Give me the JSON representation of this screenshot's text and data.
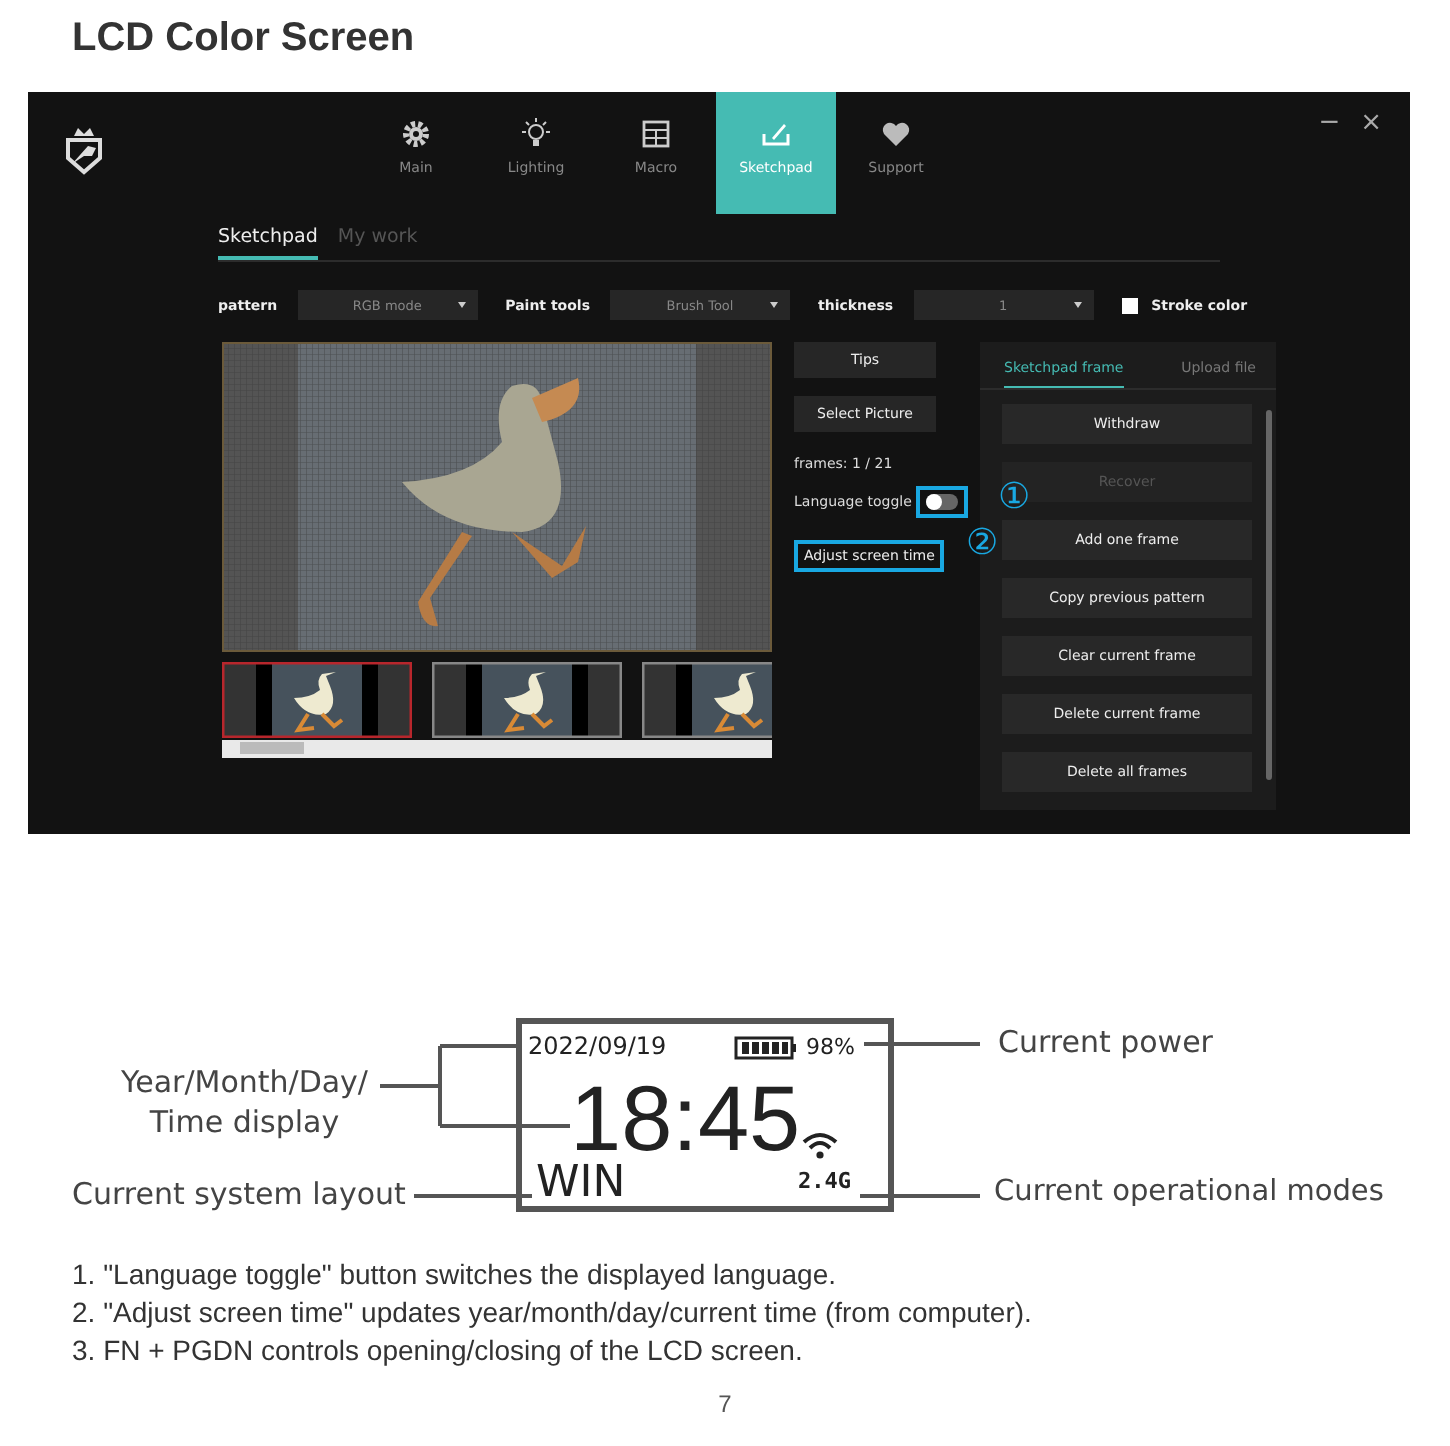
{
  "heading": "LCD Color Screen",
  "app": {
    "nav": [
      {
        "label": "Main",
        "kind": "gear",
        "selected": false
      },
      {
        "label": "Lighting",
        "kind": "bulb",
        "selected": false
      },
      {
        "label": "Macro",
        "kind": "table",
        "selected": false
      },
      {
        "label": "Sketchpad",
        "kind": "pad",
        "selected": true
      },
      {
        "label": "Support",
        "kind": "heart",
        "selected": false
      }
    ],
    "window_controls": [
      "−",
      "×"
    ],
    "subtabs": [
      {
        "label": "Sketchpad",
        "selected": true
      },
      {
        "label": "My work",
        "selected": false
      }
    ],
    "fields": [
      {
        "label": "pattern",
        "value": "RGB mode"
      },
      {
        "label": "Paint tools",
        "value": "Brush Tool"
      },
      {
        "label": "thickness",
        "value": "1"
      }
    ],
    "stroke_color": {
      "label": "Stroke color",
      "checked": false
    },
    "thumbnails": [
      {
        "selected": true
      },
      {
        "selected": false
      },
      {
        "selected": false
      }
    ],
    "side_buttons": [
      "Tips",
      "Select Picture"
    ],
    "frames": "frames: 1 / 21",
    "language_toggle": {
      "label": "Language toggle",
      "on": false,
      "callout": "①"
    },
    "adjust_button": {
      "label": "Adjust screen time",
      "callout": "②"
    },
    "panel": {
      "tabs": [
        {
          "label": "Sketchpad frame",
          "selected": true
        },
        {
          "label": "Upload file",
          "selected": false
        }
      ],
      "buttons": [
        {
          "label": "Withdraw",
          "disabled": false
        },
        {
          "label": "Recover",
          "disabled": true
        },
        {
          "label": "Add one frame",
          "disabled": false
        },
        {
          "label": "Copy previous pattern",
          "disabled": false
        },
        {
          "label": "Clear current frame",
          "disabled": false
        },
        {
          "label": "Delete current frame",
          "disabled": false
        },
        {
          "label": "Delete all frames",
          "disabled": false
        }
      ]
    }
  },
  "lcd": {
    "date": "2022/09/19",
    "battery": "98%",
    "time": "18:45",
    "layout": "WIN",
    "mode": "2.4G",
    "labels": {
      "datetime": "Year/Month/Day/\nTime display",
      "power": "Current power",
      "layout": "Current system layout",
      "mode": "Current operational modes"
    }
  },
  "notes": [
    "1. \"Language toggle\" button switches the displayed language.",
    "2. \"Adjust screen time\" updates year/month/day/current time (from computer).",
    "3. FN + PGDN controls opening/closing of the LCD screen."
  ],
  "page_number": "7"
}
